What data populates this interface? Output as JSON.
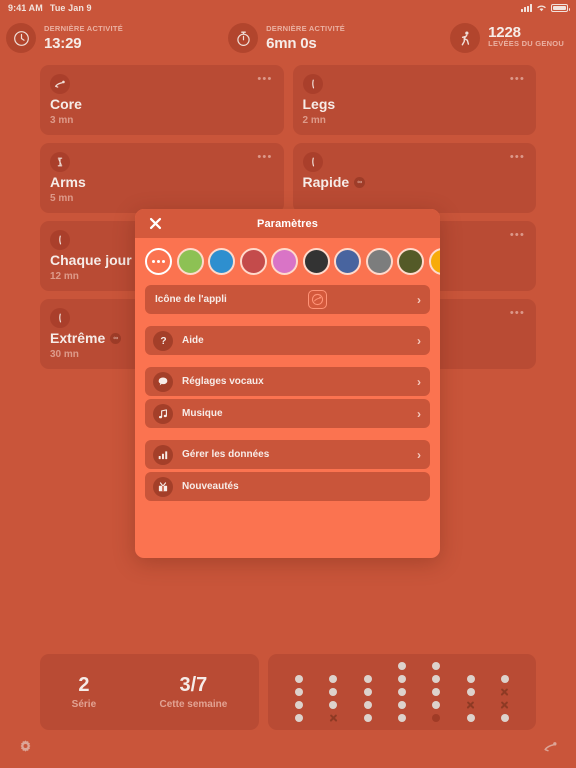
{
  "status_bar": {
    "time": "9:41 AM",
    "date": "Tue Jan 9",
    "signal_icon": "cellular-signal-icon",
    "wifi_icon": "wifi-icon",
    "battery_icon": "battery-icon"
  },
  "header": {
    "stats": [
      {
        "icon": "clock-icon",
        "label": "DERNIÈRE ACTIVITÉ",
        "value": "13:29",
        "layout": "stacked"
      },
      {
        "icon": "stopwatch-icon",
        "label": "DERNIÈRE ACTIVITÉ",
        "value": "6mn 0s",
        "layout": "stacked"
      },
      {
        "icon": "runner-icon",
        "label": "LEVÉES DU GENOU",
        "value": "1228",
        "layout": "inline"
      }
    ]
  },
  "workouts": [
    {
      "icon": "stretch-icon",
      "title": "Core",
      "duration": "3 mn",
      "infinite": false,
      "wide": false,
      "menu": "•••"
    },
    {
      "icon": "leg-icon",
      "title": "Legs",
      "duration": "2 mn",
      "infinite": false,
      "wide": false,
      "menu": "•••"
    },
    {
      "icon": "arm-icon",
      "title": "Arms",
      "duration": "5 mn",
      "infinite": false,
      "wide": false,
      "menu": "•••"
    },
    {
      "icon": "leg-icon",
      "title": "Rapide",
      "duration": "",
      "infinite": true,
      "wide": false,
      "menu": "•••"
    },
    {
      "icon": "leg-icon",
      "title": "Chaque jour",
      "duration": "12 mn",
      "infinite": true,
      "wide": true,
      "menu": "•••"
    },
    {
      "icon": "leg-icon",
      "title": "Extrême",
      "duration": "30 mn",
      "infinite": true,
      "wide": true,
      "menu": "•••"
    }
  ],
  "modal": {
    "title": "Paramètres",
    "close_icon": "close-icon",
    "swatches": [
      {
        "name": "more-colors",
        "color": "",
        "selected": true
      },
      {
        "name": "green",
        "color": "#8dc154",
        "selected": false
      },
      {
        "name": "blue",
        "color": "#2e8fcf",
        "selected": false
      },
      {
        "name": "red",
        "color": "#c44b4b",
        "selected": false
      },
      {
        "name": "pink",
        "color": "#d974c6",
        "selected": false
      },
      {
        "name": "black",
        "color": "#333333",
        "selected": false
      },
      {
        "name": "navy",
        "color": "#48649f",
        "selected": false
      },
      {
        "name": "gray",
        "color": "#7c7d7d",
        "selected": false
      },
      {
        "name": "olive",
        "color": "#545a28",
        "selected": false
      },
      {
        "name": "yellow",
        "color": "#f7ab0a",
        "selected": false
      },
      {
        "name": "brown",
        "color": "#9a6335",
        "selected": false
      }
    ],
    "groups": [
      {
        "rows": [
          {
            "name": "app-icon",
            "icon": "",
            "label": "Icône de l'appli",
            "preview_icon": "app-preview-icon",
            "chevron": "›"
          }
        ]
      },
      {
        "rows": [
          {
            "name": "help",
            "icon": "question-mark-icon",
            "label": "Aide",
            "preview_icon": "",
            "chevron": "›"
          }
        ]
      },
      {
        "rows": [
          {
            "name": "voice-settings",
            "icon": "speech-bubble-icon",
            "label": "Réglages vocaux",
            "preview_icon": "",
            "chevron": "›"
          },
          {
            "name": "music",
            "icon": "music-note-icon",
            "label": "Musique",
            "preview_icon": "",
            "chevron": "›"
          }
        ]
      },
      {
        "rows": [
          {
            "name": "manage-data",
            "icon": "bar-chart-icon",
            "label": "Gérer les données",
            "preview_icon": "",
            "chevron": "›"
          },
          {
            "name": "whats-new",
            "icon": "gift-icon",
            "label": "Nouveautés",
            "preview_icon": "",
            "chevron": ""
          }
        ]
      }
    ]
  },
  "bottom": {
    "streak": [
      {
        "value": "2",
        "label": "Série"
      },
      {
        "value": "3/7",
        "label": "Cette semaine"
      }
    ],
    "activity_grid": {
      "legend": {
        "dot": "completed",
        "x": "missed",
        "faint": "empty"
      },
      "columns": [
        [
          "none",
          "dot",
          "dot",
          "dot",
          "dot"
        ],
        [
          "none",
          "dot",
          "dot",
          "dot",
          "x"
        ],
        [
          "none",
          "dot",
          "dot",
          "dot",
          "dot"
        ],
        [
          "dot",
          "dot",
          "dot",
          "dot",
          "dot"
        ],
        [
          "dot",
          "dot",
          "dot",
          "dot",
          "faint"
        ],
        [
          "dot",
          "dot",
          "x",
          "dot",
          "none"
        ],
        [
          "dot",
          "x",
          "x",
          "dot",
          "none"
        ]
      ]
    }
  },
  "footer": {
    "settings_icon": "gear-icon",
    "workout_icon": "stretch-icon"
  },
  "colors": {
    "page_bg": "#c9553a",
    "card_bg": "#b94b34",
    "modal_bg": "#fb7350",
    "modal_header_bg": "#d4593c",
    "row_bg": "#c9553a",
    "text": "#f6ece8"
  }
}
